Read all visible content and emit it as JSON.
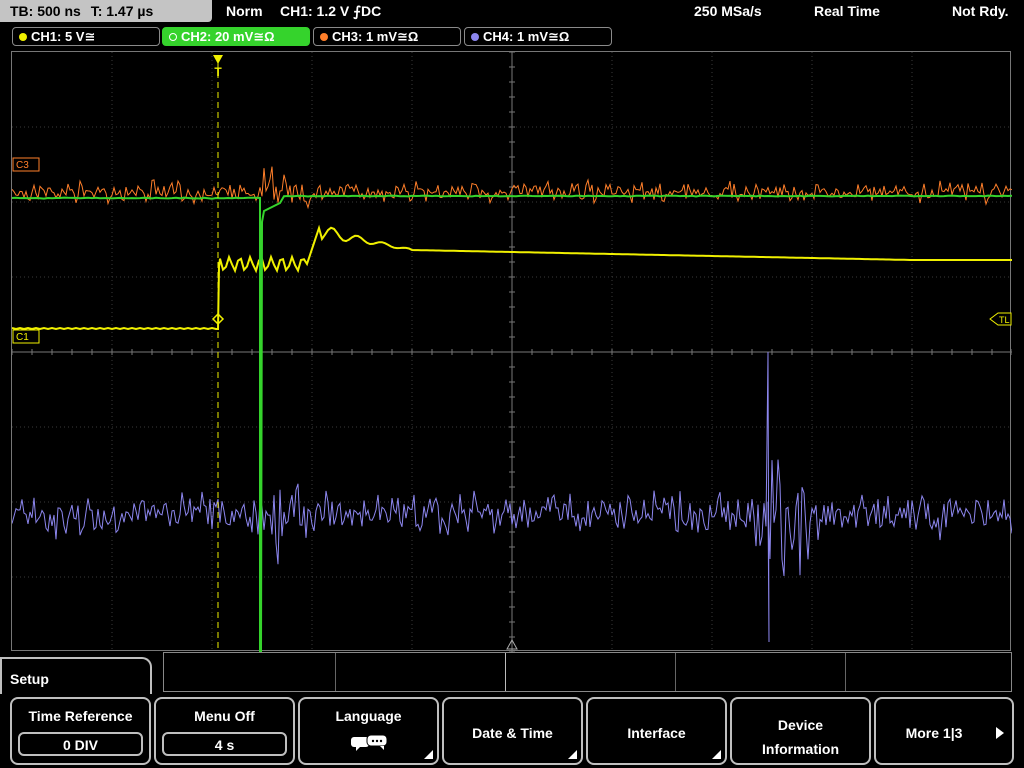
{
  "header": {
    "timebase": "TB: 500 ns",
    "trigger_time": "T: 1.47 µs",
    "mode": "Norm",
    "trigger_info": "CH1: 1.2 V ⨍DC",
    "sample_rate": "250 MSa/s",
    "acq_mode": "Real Time",
    "status": "Not Rdy."
  },
  "channels": [
    {
      "label": "CH1: 5 V≅",
      "color": "#f0f000"
    },
    {
      "label": "CH2: 20 mV≅Ω",
      "color": "#35d32c"
    },
    {
      "label": "CH3: 1 mV≅Ω",
      "color": "#ff7f2a"
    },
    {
      "label": "CH4: 1 mV≅Ω",
      "color": "#8c86ee"
    }
  ],
  "markers": {
    "trigger": "T",
    "c3": "C3",
    "c1": "C1",
    "trigger_level": "TL"
  },
  "menu": {
    "title": "Setup",
    "buttons": [
      {
        "label": "Time Reference",
        "value": "0 DIV"
      },
      {
        "label": "Menu Off",
        "value": "4 s"
      },
      {
        "label": "Language",
        "icon": "speech-bubble-icon"
      },
      {
        "label": "Date & Time"
      },
      {
        "label": "Interface"
      },
      {
        "label": "Device Information"
      },
      {
        "label": "More 1|3"
      }
    ]
  }
}
